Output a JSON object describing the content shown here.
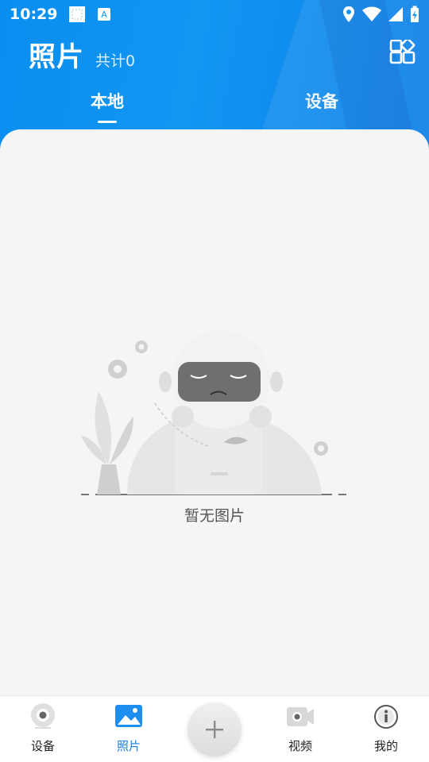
{
  "status_bar": {
    "time": "10:29"
  },
  "header": {
    "title": "照片",
    "count_label": "共计0",
    "tabs": [
      {
        "label": "本地",
        "active": true
      },
      {
        "label": "设备",
        "active": false
      }
    ]
  },
  "empty_state": {
    "message": "暂无图片"
  },
  "bottom_nav": {
    "items": [
      {
        "label": "设备",
        "icon": "camera-device-icon",
        "active": false
      },
      {
        "label": "照片",
        "icon": "photo-icon",
        "active": true
      },
      {
        "label": "视频",
        "icon": "video-icon",
        "active": false
      },
      {
        "label": "我的",
        "icon": "info-icon",
        "active": false
      }
    ],
    "add_icon": "plus-icon"
  },
  "colors": {
    "primary": "#1296f2",
    "active_tab": "#1a7fe3",
    "background": "#f5f5f5"
  }
}
